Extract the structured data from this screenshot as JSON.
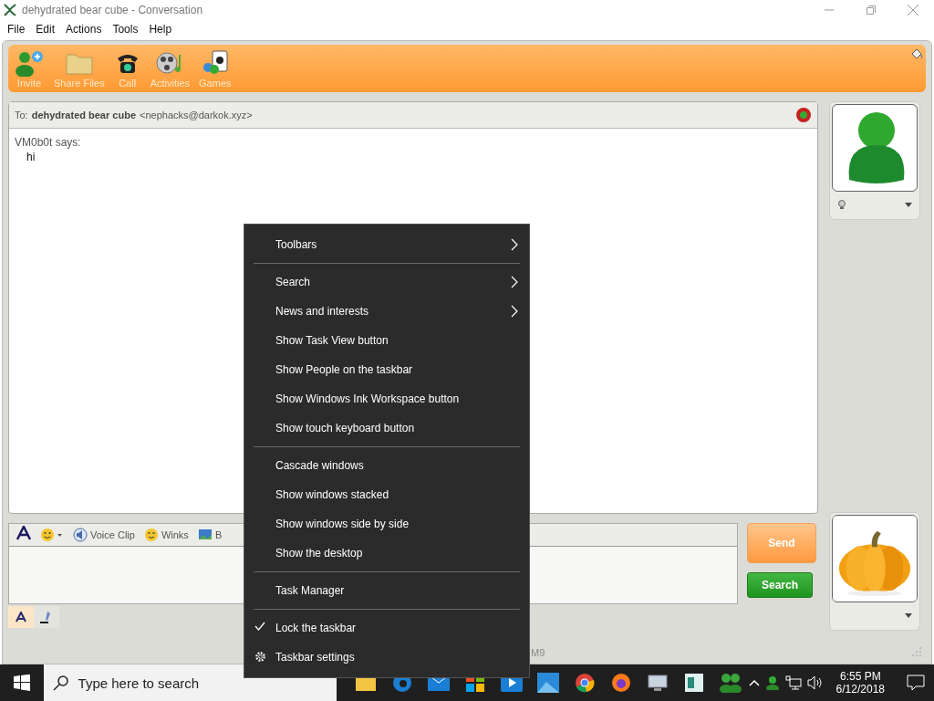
{
  "window": {
    "title": "dehydrated bear cube - Conversation"
  },
  "menu_bar": [
    "File",
    "Edit",
    "Actions",
    "Tools",
    "Help"
  ],
  "toolbar": [
    {
      "kind": "invite",
      "label": "Invite"
    },
    {
      "kind": "folder",
      "label": "Share Files"
    },
    {
      "kind": "phone",
      "label": "Call"
    },
    {
      "kind": "film",
      "label": "Activities"
    },
    {
      "kind": "cards",
      "label": "Games"
    }
  ],
  "header": {
    "label": "To:",
    "name": "dehydrated bear cube",
    "email": "<nephacks@darkok.xyz>"
  },
  "messages": [
    {
      "sender": "VM0b0t says:",
      "text": "hi"
    }
  ],
  "compose_toolbar": [
    {
      "kind": "font"
    },
    {
      "kind": "emoticon"
    },
    {
      "kind": "voice",
      "label": "Voice Clip"
    },
    {
      "kind": "winks",
      "label": "Winks"
    },
    {
      "kind": "background",
      "label": "B"
    }
  ],
  "compose_tabs": [
    {
      "kind": "font",
      "selected": true
    },
    {
      "kind": "ink",
      "selected": false
    }
  ],
  "buttons": {
    "send": "Send",
    "search": "Search"
  },
  "status_bar": "M9",
  "context_menu": [
    {
      "kind": "item",
      "label": "Toolbars",
      "submenu": true,
      "checked": false
    },
    {
      "kind": "separator"
    },
    {
      "kind": "item",
      "label": "Search",
      "submenu": true,
      "checked": false
    },
    {
      "kind": "item",
      "label": "News and interests",
      "submenu": true,
      "checked": false
    },
    {
      "kind": "item",
      "label": "Show Task View button",
      "submenu": false,
      "checked": false
    },
    {
      "kind": "item",
      "label": "Show People on the taskbar",
      "submenu": false,
      "checked": false
    },
    {
      "kind": "item",
      "label": "Show Windows Ink Workspace button",
      "submenu": false,
      "checked": false
    },
    {
      "kind": "item",
      "label": "Show touch keyboard button",
      "submenu": false,
      "checked": false
    },
    {
      "kind": "separator"
    },
    {
      "kind": "item",
      "label": "Cascade windows",
      "submenu": false,
      "checked": false
    },
    {
      "kind": "item",
      "label": "Show windows stacked",
      "submenu": false,
      "checked": false
    },
    {
      "kind": "item",
      "label": "Show windows side by side",
      "submenu": false,
      "checked": false
    },
    {
      "kind": "item",
      "label": "Show the desktop",
      "submenu": false,
      "checked": false
    },
    {
      "kind": "separator"
    },
    {
      "kind": "item",
      "label": "Task Manager",
      "submenu": false,
      "checked": false
    },
    {
      "kind": "separator"
    },
    {
      "kind": "item",
      "label": "Lock the taskbar",
      "submenu": false,
      "checked": true
    },
    {
      "kind": "settings",
      "label": "Taskbar settings",
      "submenu": false,
      "checked": false
    }
  ],
  "taskbar": {
    "search_placeholder": "Type here to search",
    "time": "6:55 PM",
    "date": "6/12/2018"
  }
}
